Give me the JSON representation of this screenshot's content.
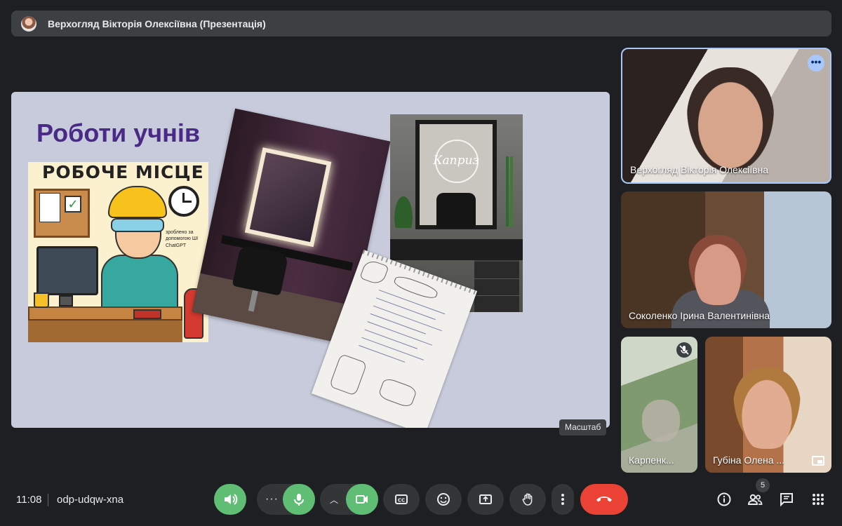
{
  "presenter": {
    "name": "Верхогляд Вікторія Олексіївна (Презентація)"
  },
  "slide": {
    "title": "Роботи учнів",
    "poster": {
      "heading": "РОБОЧЕ МІСЦЕ",
      "note": "зроблено за допомогою ШІ ChatGPT"
    },
    "photo_logo": "Каприз"
  },
  "tooltip": "Масштаб",
  "participants": [
    {
      "name": "Верхогляд Вікторія Олексіївна"
    },
    {
      "name": "Соколенко Ірина Валентинівна"
    },
    {
      "name": "Карпенк..."
    },
    {
      "name": "Губіна Олена ..."
    }
  ],
  "bottom_bar": {
    "time": "11:08",
    "meeting_code": "odp-udqw-xna",
    "participant_count": "5"
  },
  "colors": {
    "accent_green": "#5fbd74",
    "end_call_red": "#ea4335",
    "active_outline": "#a8c7fa"
  }
}
